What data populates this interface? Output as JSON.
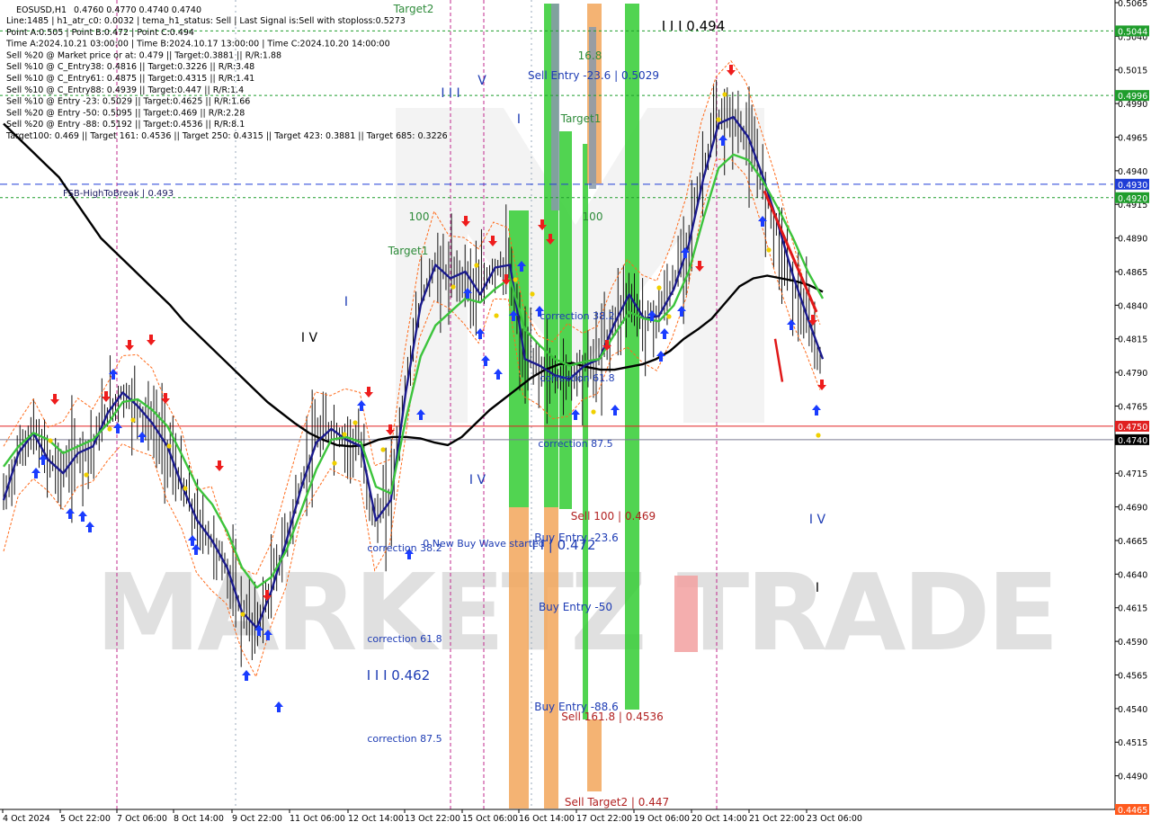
{
  "chart_data": {
    "type": "line",
    "symbol": "EOSUSD,H1",
    "ohlc_header": "0.4760 0.4770 0.4740 0.4740",
    "info_lines": [
      "Line:1485 | h1_atr_c0: 0.0032 | tema_h1_status: Sell | Last Signal is:Sell with stoploss:0.5273",
      "Point A:0.505 | Point B:0.472 | Point C:0.494",
      "Time A:2024.10.21 03:00:00 | Time B:2024.10.17 13:00:00 | Time C:2024.10.20 14:00:00",
      "Sell %20 @ Market price or at: 0.479 || Target:0.3881 || R/R:1.88",
      "Sell %10 @ C_Entry38: 0.4816 || Target:0.3226 || R/R:3.48",
      "Sell %10 @ C_Entry61: 0.4875 || Target:0.4315 || R/R:1.41",
      "Sell %10 @ C_Entry88: 0.4939 || Target:0.447 || R/R:1.4",
      "Sell %10 @ Entry -23: 0.5029 || Target:0.4625 || R/R:1.66",
      "Sell %20 @ Entry -50: 0.5095 || Target:0.469 || R/R:2.28",
      "Sell %20 @ Entry -88: 0.5192 || Target:0.4536 || R/R:8.1",
      "Target100: 0.469 || Target 161: 0.4536 || Target 250: 0.4315 || Target 423: 0.3881 || Target 685: 0.3226"
    ],
    "ylim": [
      0.4465,
      0.5067
    ],
    "y_ticks": [
      "0.5065",
      "0.5040",
      "0.5015",
      "0.4990",
      "0.4965",
      "0.4940",
      "0.4915",
      "0.4890",
      "0.4865",
      "0.4840",
      "0.4815",
      "0.4790",
      "0.4765",
      "0.4740",
      "0.4715",
      "0.4690",
      "0.4665",
      "0.4640",
      "0.4615",
      "0.4590",
      "0.4565",
      "0.4540",
      "0.4515",
      "0.4490"
    ],
    "x_ticks": [
      "4 Oct 2024",
      "5 Oct 22:00",
      "7 Oct 06:00",
      "8 Oct 14:00",
      "9 Oct 22:00",
      "11 Oct 06:00",
      "12 Oct 14:00",
      "13 Oct 22:00",
      "15 Oct 06:00",
      "16 Oct 14:00",
      "17 Oct 22:00",
      "19 Oct 06:00",
      "20 Oct 14:00",
      "21 Oct 22:00",
      "23 Oct 06:00"
    ],
    "price_labels": [
      {
        "text": "0.5044",
        "value": 0.5044,
        "color": "#1f9d2c"
      },
      {
        "text": "0.4996",
        "value": 0.4996,
        "color": "#1f9d2c"
      },
      {
        "text": "0.4930",
        "value": 0.493,
        "color": "#1e3cd6"
      },
      {
        "text": "0.4920",
        "value": 0.492,
        "color": "#1f9d2c"
      },
      {
        "text": "0.4750",
        "value": 0.475,
        "color": "#e02020"
      },
      {
        "text": "0.4740",
        "value": 0.474,
        "color": "#000000"
      },
      {
        "text": "0.4465",
        "value": 0.4465,
        "color": "#ff5a1e"
      }
    ],
    "level_lines": [
      {
        "value": 0.5044,
        "color": "#1f9d2c",
        "dash": "3,3"
      },
      {
        "value": 0.4996,
        "color": "#1f9d2c",
        "dash": "3,3"
      },
      {
        "value": 0.493,
        "color": "#1e3cd6",
        "dash": "8,5"
      },
      {
        "value": 0.492,
        "color": "#1f9d2c",
        "dash": "3,3"
      },
      {
        "value": 0.475,
        "color": "#e02020",
        "dash": ""
      },
      {
        "value": 0.474,
        "color": "#7a7a90",
        "dash": ""
      },
      {
        "value": 0.4465,
        "color": "#ff5a1e",
        "dash": "3,3"
      }
    ],
    "annotations": [
      {
        "text": "FSB-HighToBreak | 0.493",
        "color": "#1a1a60",
        "size": 10
      },
      {
        "text": "Target2",
        "color": "#2e8b3a",
        "size": 12
      },
      {
        "text": "I I I 0.494",
        "color": "#000000",
        "size": 15
      },
      {
        "text": "16.8",
        "color": "#2e8b3a",
        "size": 12
      },
      {
        "text": "Sell Entry -23.6 | 0.5029",
        "color": "#1e3cb4",
        "size": 12
      },
      {
        "text": "Target1",
        "color": "#2e8b3a",
        "size": 12
      },
      {
        "text": "100",
        "color": "#2e8b3a",
        "size": 12
      },
      {
        "text": "Target1",
        "color": "#2e8b3a",
        "size": 12
      },
      {
        "text": "100",
        "color": "#2e8b3a",
        "size": 12
      },
      {
        "text": "I I I",
        "color": "#1e3cb4",
        "size": 14
      },
      {
        "text": "V",
        "color": "#1e3cb4",
        "size": 14
      },
      {
        "text": "I",
        "color": "#1e3cb4",
        "size": 14
      },
      {
        "text": "I",
        "color": "#1e3cb4",
        "size": 14
      },
      {
        "text": "I V",
        "color": "#000000",
        "size": 14
      },
      {
        "text": "correction 38.2",
        "color": "#1e3cb4",
        "size": 11
      },
      {
        "text": "correction 61.8",
        "color": "#1e3cb4",
        "size": 11
      },
      {
        "text": "correction 87.5",
        "color": "#1e3cb4",
        "size": 11
      },
      {
        "text": "I V",
        "color": "#1e3cb4",
        "size": 14
      },
      {
        "text": "Sell 100 | 0.469",
        "color": "#b22222",
        "size": 12
      },
      {
        "text": "correction 38.2",
        "color": "#1e3cb4",
        "size": 11
      },
      {
        "text": "0 New Buy Wave started",
        "color": "#1e3cb4",
        "size": 11
      },
      {
        "text": "Buy Entry -23.6",
        "color": "#1e3cb4",
        "size": 12
      },
      {
        "text": "I I | 0.472",
        "color": "#1e3cb4",
        "size": 15
      },
      {
        "text": "Buy Entry -50",
        "color": "#1e3cb4",
        "size": 12
      },
      {
        "text": "correction 61.8",
        "color": "#1e3cb4",
        "size": 11
      },
      {
        "text": "I I I 0.462",
        "color": "#1e3cb4",
        "size": 15
      },
      {
        "text": "Buy Entry -88.6",
        "color": "#1e3cb4",
        "size": 12
      },
      {
        "text": "Sell 161.8 | 0.4536",
        "color": "#b22222",
        "size": 12
      },
      {
        "text": "correction 87.5",
        "color": "#1e3cb4",
        "size": 11
      },
      {
        "text": "Sell Target2 | 0.447",
        "color": "#b22222",
        "size": 12
      },
      {
        "text": "I V",
        "color": "#1e3cb4",
        "size": 14
      },
      {
        "text": "I",
        "color": "#000000",
        "size": 14
      }
    ],
    "watermark": "MARKETZ TRADE",
    "series": [
      {
        "color": "#000000",
        "values": [
          0.4975,
          0.4965,
          0.4955,
          0.4945,
          0.4935,
          0.492,
          0.4905,
          0.489,
          0.488,
          0.487,
          0.486,
          0.485,
          0.484,
          0.4828,
          0.4818,
          0.4808,
          0.4798,
          0.4788,
          0.4778,
          0.4768,
          0.476,
          0.4752,
          0.4745,
          0.474,
          0.4736,
          0.4735,
          0.4736,
          0.474,
          0.4742,
          0.4742,
          0.4741,
          0.4738,
          0.4736,
          0.4742,
          0.4752,
          0.4762,
          0.477,
          0.4778,
          0.4786,
          0.4792,
          0.4796,
          0.4797,
          0.4794,
          0.4792,
          0.4792,
          0.4794,
          0.4796,
          0.48,
          0.4806,
          0.4815,
          0.4822,
          0.483,
          0.4842,
          0.4854,
          0.486,
          0.4862,
          0.486,
          0.4858,
          0.4855,
          0.485
        ]
      },
      {
        "color": "#1a1a8c",
        "values": [
          0.4695,
          0.473,
          0.4745,
          0.4725,
          0.4715,
          0.473,
          0.4735,
          0.476,
          0.4775,
          0.4765,
          0.4752,
          0.4735,
          0.4705,
          0.468,
          0.4665,
          0.4645,
          0.4612,
          0.46,
          0.4628,
          0.4665,
          0.4705,
          0.4738,
          0.4748,
          0.474,
          0.4735,
          0.468,
          0.4695,
          0.4775,
          0.484,
          0.487,
          0.486,
          0.4865,
          0.4848,
          0.4868,
          0.487,
          0.48,
          0.4795,
          0.4788,
          0.4785,
          0.4795,
          0.48,
          0.4826,
          0.4848,
          0.483,
          0.4832,
          0.4852,
          0.4885,
          0.4935,
          0.4975,
          0.498,
          0.4965,
          0.4935,
          0.49,
          0.4862,
          0.483,
          0.48
        ]
      },
      {
        "color": "#3cc43c",
        "values": [
          0.472,
          0.4735,
          0.4745,
          0.474,
          0.473,
          0.4735,
          0.474,
          0.4752,
          0.4768,
          0.477,
          0.4762,
          0.475,
          0.4728,
          0.4705,
          0.4692,
          0.4672,
          0.4645,
          0.463,
          0.4638,
          0.4658,
          0.4688,
          0.4718,
          0.474,
          0.4742,
          0.4738,
          0.4705,
          0.47,
          0.4755,
          0.4802,
          0.4825,
          0.4835,
          0.4845,
          0.4842,
          0.4852,
          0.486,
          0.4822,
          0.481,
          0.48,
          0.4795,
          0.4798,
          0.48,
          0.4818,
          0.4835,
          0.483,
          0.4828,
          0.484,
          0.4865,
          0.4905,
          0.4942,
          0.4952,
          0.4948,
          0.4932,
          0.4912,
          0.489,
          0.4865,
          0.4845
        ]
      }
    ],
    "vertical_lines_color": "#c0288c",
    "grid": false,
    "legend": "none"
  }
}
